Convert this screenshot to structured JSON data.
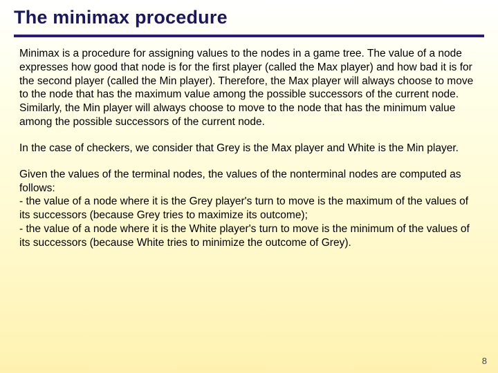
{
  "slide": {
    "title": "The minimax procedure",
    "paragraphs": {
      "p1": "Minimax is a procedure for assigning values to the nodes in a game tree. The value of a node expresses how good that node is for the first player (called the Max player) and how bad it is for the second player (called the Min player). Therefore, the Max player will always choose to move to the node that has the maximum value among the possible successors of the current node. Similarly, the Min player will always choose to move to the node that has the minimum value among the possible successors of the current node.",
      "p2": "In the case of checkers, we consider that Grey is the Max player and White is the Min player.",
      "p3": "Given the values of the terminal nodes, the values of the nonterminal nodes are computed as follows:\n- the value of a node where it is the Grey player's turn to move is the maximum of the values of its successors (because Grey tries to maximize its outcome);\n- the value of a node where it is the White player's turn to move is the minimum of the values of its successors (because White tries to minimize the outcome of Grey)."
    },
    "page_number": "8"
  }
}
